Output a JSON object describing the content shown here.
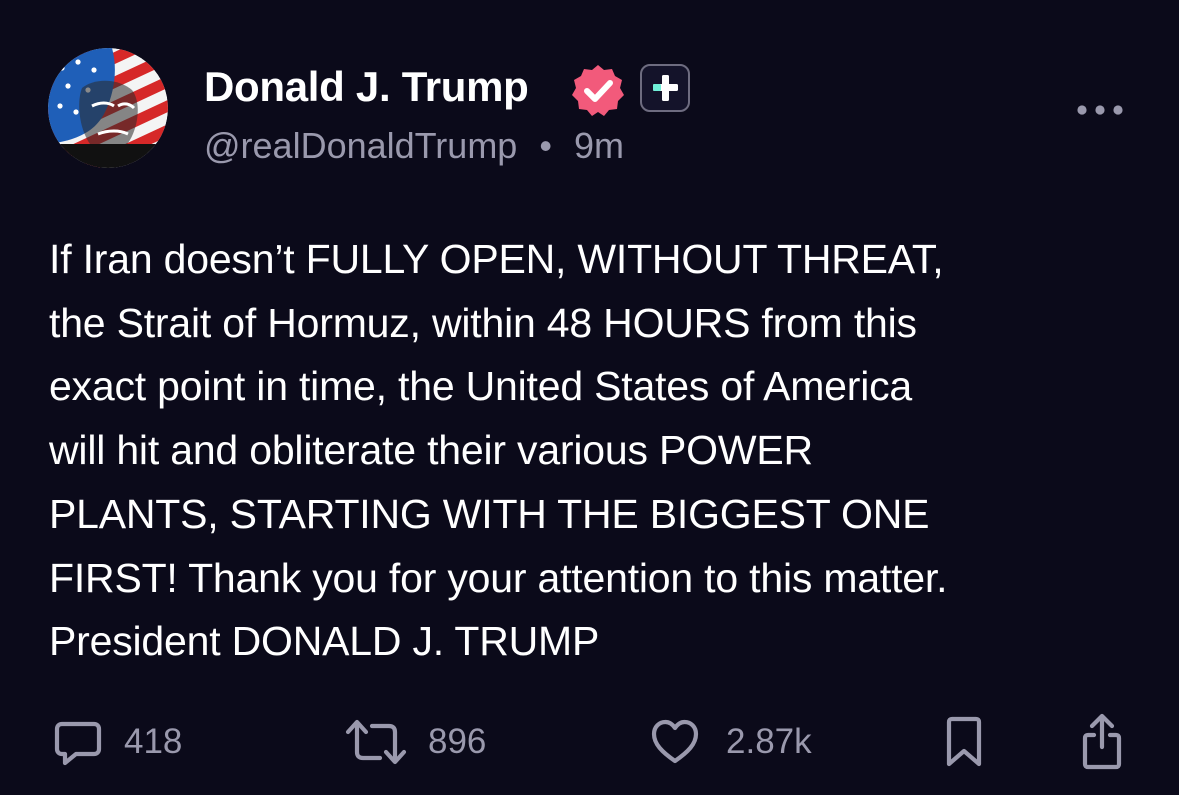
{
  "post": {
    "author": {
      "display_name": "Donald J. Trump",
      "handle": "@realDonaldTrump",
      "separator": "•",
      "time_ago": "9m",
      "verified_icon": "verified-badge-icon",
      "plus_icon": "plus-badge-icon"
    },
    "text": "If Iran doesn’t FULLY OPEN, WITHOUT THREAT,\nthe Strait of Hormuz, within 48 HOURS from this\nexact point in time, the United States of America\nwill hit and obliterate their various POWER\nPLANTS, STARTING WITH THE BIGGEST ONE\nFIRST! Thank you for your attention to this matter.\nPresident DONALD J. TRUMP",
    "actions": {
      "reply": {
        "icon": "reply-icon",
        "count": "418"
      },
      "repost": {
        "icon": "repost-icon",
        "count": "896"
      },
      "like": {
        "icon": "heart-icon",
        "count": "2.87k"
      },
      "bookmark": {
        "icon": "bookmark-icon"
      },
      "share": {
        "icon": "share-icon"
      }
    }
  },
  "colors": {
    "background": "#0b0a1a",
    "text": "#ffffff",
    "muted": "#9a99ad",
    "verified": "#f25a7b",
    "plus_accent": "#6ff0d8"
  }
}
